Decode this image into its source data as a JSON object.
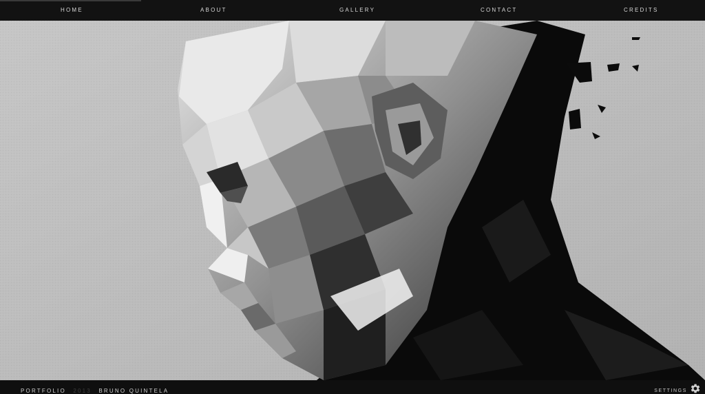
{
  "nav": {
    "items": [
      {
        "label": "HOME"
      },
      {
        "label": "ABOUT"
      },
      {
        "label": "GALLERY"
      },
      {
        "label": "CONTACT"
      },
      {
        "label": "CREDITS"
      }
    ],
    "progress": 0.2
  },
  "hero": {
    "image_icon": "low-poly-portrait-icon",
    "background_color": "#bdbdbd"
  },
  "footer": {
    "portfolio_label": "PORTFOLIO",
    "year": "2013",
    "name": "BRUNO QUINTELA",
    "settings_label": "SETTINGS",
    "settings_icon": "gear-icon"
  }
}
